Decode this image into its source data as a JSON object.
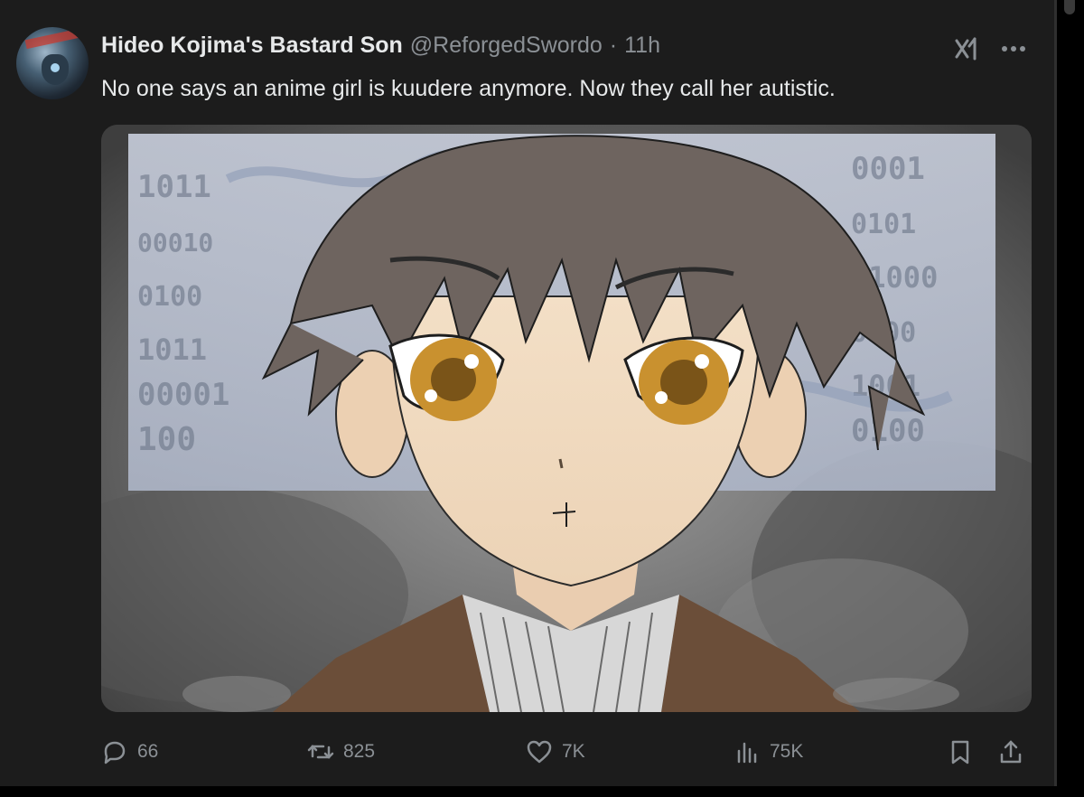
{
  "tweet": {
    "display_name": "Hideo Kojima's Bastard Son",
    "handle": "@ReforgedSwordo",
    "separator": "·",
    "time": "11h",
    "text": "No one says an anime girl is kuudere anymore. Now they call her autistic."
  },
  "media": {
    "kind": "drawing",
    "alt": "Sketch of an anime boy with brown hair and amber eyes over a grey cloudy background with binary digits"
  },
  "actions": {
    "replies": "66",
    "retweets": "825",
    "likes": "7K",
    "views": "75K"
  },
  "icons": {
    "reply": "reply-icon",
    "retweet": "retweet-icon",
    "like": "heart-icon",
    "views": "views-icon",
    "bookmark": "bookmark-icon",
    "share": "share-icon",
    "grok": "grok-icon",
    "more": "more-icon"
  },
  "colors": {
    "background": "#1c1c1c",
    "text_primary": "#e7e9ea",
    "text_secondary": "#8b9095"
  }
}
